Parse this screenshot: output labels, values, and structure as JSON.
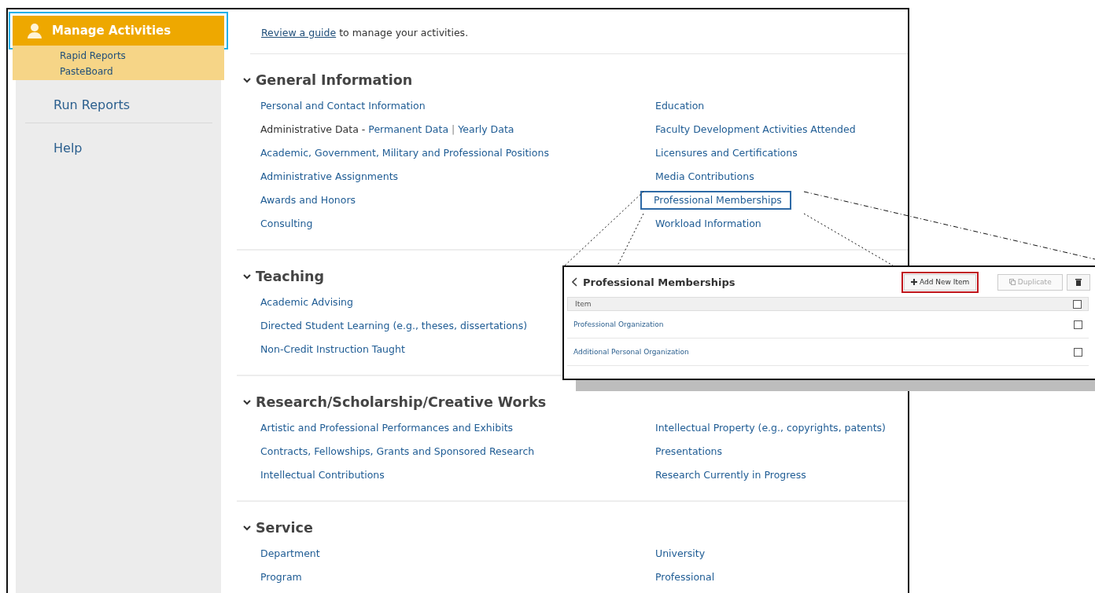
{
  "sidebar": {
    "active": {
      "label": "Manage Activities",
      "selected": true,
      "children": [
        {
          "label": "Rapid Reports"
        },
        {
          "label": "PasteBoard"
        }
      ]
    },
    "items": [
      {
        "label": "Run Reports"
      },
      {
        "label": "Help"
      }
    ]
  },
  "intro": {
    "link": "Review a guide",
    "text": "to manage your activities."
  },
  "sections": [
    {
      "title": "General Information",
      "expanded": true,
      "left": [
        {
          "kind": "link",
          "text": "Personal and Contact Information",
          "highlighted": false
        },
        {
          "kind": "group",
          "label": "Administrative Data -",
          "links": [
            "Permanent Data",
            "Yearly Data"
          ],
          "separator": "|"
        },
        {
          "kind": "link",
          "text": "Academic, Government, Military and Professional Positions",
          "highlighted": false
        },
        {
          "kind": "link",
          "text": "Administrative Assignments",
          "highlighted": false
        },
        {
          "kind": "link",
          "text": "Awards and Honors",
          "highlighted": false
        },
        {
          "kind": "link",
          "text": "Consulting",
          "highlighted": false
        }
      ],
      "right": [
        {
          "kind": "link",
          "text": "Education",
          "highlighted": false
        },
        {
          "kind": "link",
          "text": "Faculty Development Activities Attended",
          "highlighted": false
        },
        {
          "kind": "link",
          "text": "Licensures and Certifications",
          "highlighted": false
        },
        {
          "kind": "link",
          "text": "Media Contributions",
          "highlighted": false
        },
        {
          "kind": "link",
          "text": "Professional Memberships",
          "highlighted": true
        },
        {
          "kind": "link",
          "text": "Workload Information",
          "highlighted": false
        }
      ]
    },
    {
      "title": "Teaching",
      "expanded": true,
      "left": [
        {
          "kind": "link",
          "text": "Academic Advising",
          "highlighted": false
        },
        {
          "kind": "link",
          "text": "Directed Student Learning (e.g., theses, dissertations)",
          "highlighted": false
        },
        {
          "kind": "link",
          "text": "Non-Credit Instruction Taught",
          "highlighted": false
        }
      ]
    },
    {
      "title": "Research/Scholarship/Creative Works",
      "expanded": true,
      "left": [
        {
          "kind": "link",
          "text": "Artistic and Professional Performances and Exhibits",
          "highlighted": false
        },
        {
          "kind": "link",
          "text": "Contracts, Fellowships, Grants and Sponsored Research",
          "highlighted": false
        },
        {
          "kind": "link",
          "text": "Intellectual Contributions",
          "highlighted": false
        }
      ],
      "right": [
        {
          "kind": "link",
          "text": "Intellectual Property (e.g., copyrights, patents)",
          "highlighted": false
        },
        {
          "kind": "link",
          "text": "Presentations",
          "highlighted": false
        },
        {
          "kind": "link",
          "text": "Research Currently in Progress",
          "highlighted": false
        }
      ]
    },
    {
      "title": "Service",
      "expanded": true,
      "left": [
        {
          "kind": "link",
          "text": "Department",
          "highlighted": false
        },
        {
          "kind": "link",
          "text": "Program",
          "highlighted": false
        }
      ],
      "right": [
        {
          "kind": "link",
          "text": "University",
          "highlighted": false
        },
        {
          "kind": "link",
          "text": "Professional",
          "highlighted": false
        }
      ]
    }
  ],
  "callout": {
    "title": "Professional Memberships",
    "buttons": [
      {
        "kind": "add",
        "label": "Add New Item",
        "highlighted": true,
        "disabled": false
      },
      {
        "kind": "duplicate",
        "label": "Duplicate",
        "highlighted": false,
        "disabled": true
      },
      {
        "kind": "delete",
        "highlighted": false,
        "disabled": false
      }
    ],
    "column": "Item",
    "header_checked": false,
    "rows": [
      {
        "text": "Professional Organization",
        "checked": false
      },
      {
        "text": "Additional Personal Organization",
        "checked": false
      }
    ]
  }
}
